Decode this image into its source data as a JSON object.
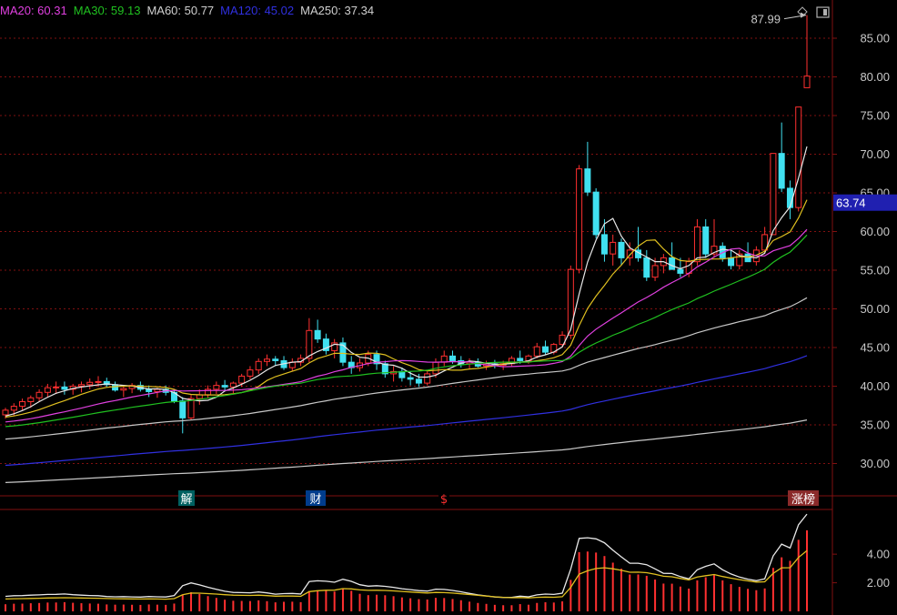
{
  "legend": [
    {
      "label": "MA20: 60.31",
      "color": "#e040e0"
    },
    {
      "label": "MA30: 59.13",
      "color": "#20c020"
    },
    {
      "label": "MA60: 50.77",
      "color": "#d0d0d0"
    },
    {
      "label": "MA120: 45.02",
      "color": "#3030e0"
    },
    {
      "label": "MA250: 37.34",
      "color": "#d0d0d0"
    }
  ],
  "colors": {
    "up": "#ff3030",
    "down": "#40e0f0",
    "grid": "#801010",
    "axis": "#801010",
    "price_box": "#2020b0"
  },
  "chart_data": [
    {
      "type": "candlestick",
      "ylim": [
        27,
        89
      ],
      "yticks": [
        "30.00",
        "35.00",
        "40.00",
        "45.00",
        "50.00",
        "55.00",
        "60.00",
        "65.00",
        "70.00",
        "75.00",
        "80.00",
        "85.00"
      ],
      "current_price_label": "63.74",
      "current_price": 63.74,
      "high_label": "87.99",
      "high_value": 87.99,
      "candles": [
        [
          36.3,
          37.2,
          35.8,
          36.9
        ],
        [
          36.9,
          37.8,
          36.2,
          37.4
        ],
        [
          37.4,
          38.4,
          36.9,
          38.0
        ],
        [
          38.0,
          38.8,
          37.2,
          38.5
        ],
        [
          38.5,
          39.6,
          38.0,
          39.2
        ],
        [
          39.2,
          40.3,
          38.6,
          39.8
        ],
        [
          39.8,
          40.6,
          39.0,
          39.9
        ],
        [
          39.9,
          40.6,
          38.9,
          39.6
        ],
        [
          39.6,
          40.3,
          38.9,
          40.0
        ],
        [
          40.0,
          40.6,
          39.2,
          40.2
        ],
        [
          40.2,
          41.0,
          39.6,
          40.5
        ],
        [
          40.5,
          41.3,
          39.9,
          40.6
        ],
        [
          40.6,
          41.1,
          39.9,
          40.2
        ],
        [
          40.2,
          40.6,
          39.3,
          39.5
        ],
        [
          39.5,
          40.0,
          38.6,
          39.7
        ],
        [
          39.7,
          40.4,
          39.1,
          40.1
        ],
        [
          40.1,
          40.6,
          39.3,
          39.6
        ],
        [
          39.6,
          40.1,
          38.6,
          39.3
        ],
        [
          39.3,
          39.8,
          38.5,
          39.6
        ],
        [
          39.6,
          40.1,
          38.8,
          39.2
        ],
        [
          39.2,
          39.6,
          37.8,
          38.1
        ],
        [
          38.1,
          38.6,
          33.9,
          35.9
        ],
        [
          35.9,
          38.9,
          35.6,
          38.4
        ],
        [
          38.4,
          39.6,
          37.6,
          38.9
        ],
        [
          38.9,
          40.1,
          38.4,
          39.6
        ],
        [
          39.6,
          40.6,
          39.0,
          40.1
        ],
        [
          40.1,
          40.8,
          39.4,
          39.9
        ],
        [
          39.9,
          40.6,
          39.1,
          40.4
        ],
        [
          40.4,
          41.6,
          39.9,
          41.3
        ],
        [
          41.3,
          42.6,
          40.9,
          42.1
        ],
        [
          42.1,
          43.6,
          41.6,
          43.2
        ],
        [
          43.2,
          44.1,
          42.6,
          43.5
        ],
        [
          43.5,
          43.9,
          42.6,
          43.3
        ],
        [
          43.3,
          43.9,
          42.1,
          42.4
        ],
        [
          42.4,
          43.6,
          41.9,
          43.1
        ],
        [
          43.1,
          44.1,
          42.6,
          43.6
        ],
        [
          43.6,
          48.8,
          43.1,
          47.2
        ],
        [
          47.2,
          48.6,
          45.6,
          46.1
        ],
        [
          46.1,
          46.8,
          44.1,
          44.6
        ],
        [
          44.6,
          46.1,
          43.6,
          45.6
        ],
        [
          45.6,
          46.3,
          42.6,
          43.1
        ],
        [
          43.1,
          43.9,
          41.6,
          42.4
        ],
        [
          42.4,
          43.6,
          41.9,
          43.0
        ],
        [
          43.0,
          44.6,
          42.6,
          44.1
        ],
        [
          44.1,
          44.6,
          42.1,
          42.9
        ],
        [
          42.9,
          43.3,
          41.1,
          41.6
        ],
        [
          41.6,
          42.6,
          40.6,
          41.9
        ],
        [
          41.9,
          42.4,
          40.6,
          41.1
        ],
        [
          41.1,
          41.9,
          40.1,
          40.9
        ],
        [
          40.9,
          41.6,
          39.9,
          40.4
        ],
        [
          40.4,
          41.9,
          40.1,
          41.6
        ],
        [
          41.6,
          43.6,
          41.1,
          43.1
        ],
        [
          43.1,
          44.6,
          42.6,
          43.9
        ],
        [
          43.9,
          44.6,
          42.9,
          43.3
        ],
        [
          43.3,
          43.9,
          42.4,
          42.9
        ],
        [
          42.9,
          43.6,
          42.3,
          43.1
        ],
        [
          43.1,
          43.6,
          42.4,
          42.6
        ],
        [
          42.6,
          43.3,
          42.1,
          42.9
        ],
        [
          42.9,
          43.4,
          42.3,
          42.7
        ],
        [
          42.7,
          43.3,
          42.1,
          42.9
        ],
        [
          42.9,
          43.9,
          42.6,
          43.6
        ],
        [
          43.6,
          44.6,
          42.9,
          43.3
        ],
        [
          43.3,
          44.1,
          42.9,
          43.9
        ],
        [
          43.9,
          45.6,
          43.6,
          45.1
        ],
        [
          45.1,
          45.9,
          44.1,
          44.4
        ],
        [
          44.4,
          45.6,
          44.1,
          45.4
        ],
        [
          45.4,
          47.1,
          45.1,
          46.6
        ],
        [
          46.6,
          55.6,
          46.1,
          55.1
        ],
        [
          55.1,
          68.6,
          54.6,
          68.1
        ],
        [
          68.1,
          71.6,
          64.6,
          65.1
        ],
        [
          65.1,
          65.6,
          59.1,
          59.6
        ],
        [
          59.6,
          61.6,
          56.1,
          57.1
        ],
        [
          57.1,
          59.6,
          55.6,
          58.6
        ],
        [
          58.6,
          59.1,
          55.6,
          56.6
        ],
        [
          56.6,
          58.6,
          55.6,
          57.6
        ],
        [
          57.6,
          60.6,
          56.1,
          56.6
        ],
        [
          56.6,
          57.6,
          53.6,
          54.1
        ],
        [
          54.1,
          56.6,
          53.6,
          55.6
        ],
        [
          55.6,
          57.1,
          54.6,
          56.6
        ],
        [
          56.6,
          58.6,
          55.1,
          55.1
        ],
        [
          55.1,
          56.6,
          54.1,
          54.6
        ],
        [
          54.6,
          56.6,
          54.1,
          56.1
        ],
        [
          56.1,
          61.6,
          55.6,
          60.6
        ],
        [
          60.6,
          61.6,
          56.6,
          57.1
        ],
        [
          57.1,
          61.6,
          56.6,
          58.1
        ],
        [
          58.1,
          58.6,
          56.1,
          56.6
        ],
        [
          56.6,
          57.6,
          55.1,
          55.6
        ],
        [
          55.6,
          57.6,
          55.1,
          57.1
        ],
        [
          57.1,
          58.6,
          56.1,
          56.1
        ],
        [
          56.1,
          58.1,
          55.6,
          57.6
        ],
        [
          57.6,
          60.6,
          57.1,
          59.6
        ],
        [
          59.6,
          70.1,
          59.6,
          70.1
        ],
        [
          70.1,
          74.1,
          65.1,
          65.6
        ],
        [
          65.6,
          66.6,
          61.6,
          63.1
        ],
        [
          63.1,
          76.1,
          62.6,
          76.1
        ],
        [
          78.6,
          87.99,
          78.6,
          80.1
        ]
      ],
      "events": [
        "解",
        "财",
        "$",
        "涨榜"
      ],
      "sub_panel": {
        "yticks": [
          "4.00",
          "2.00"
        ],
        "ylim": [
          0,
          7.0
        ]
      }
    }
  ]
}
